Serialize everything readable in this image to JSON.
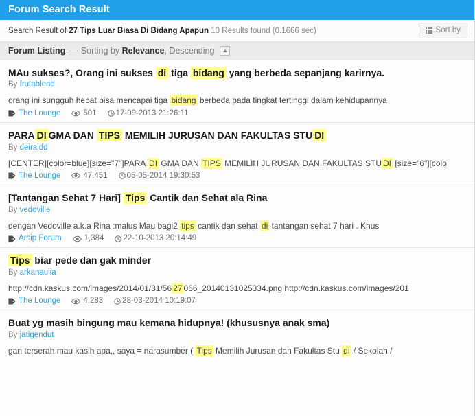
{
  "window": {
    "title": "Forum Search Result"
  },
  "summary": {
    "prefix": "Search Result of",
    "query": "27 Tips Luar Biasa Di Bidang Apapun",
    "count_text": "10 Results found (0.1666 sec)",
    "sort_button_label": "Sort by",
    "sort_button_icon": "list-icon"
  },
  "listing": {
    "title": "Forum Listing",
    "dash": "—",
    "sorting_prefix": "Sorting by",
    "sort_field": "Relevance",
    "sort_direction": "Descending",
    "collapse_icon": "chevron-up-icon"
  },
  "icons": {
    "tag": "tag-icon",
    "views": "eye-icon",
    "time": "clock-icon"
  },
  "colors": {
    "header_blue": "#1fa0e8",
    "highlight_yellow": "#ffff8d",
    "link_blue": "#3a9fd4",
    "listing_bar_gray": "#ebebeb"
  },
  "results": [
    {
      "title_parts": [
        {
          "text": "MAu sukses?, Orang ini sukses ",
          "hl": false
        },
        {
          "text": "di",
          "hl": true
        },
        {
          "text": " tiga ",
          "hl": false
        },
        {
          "text": "bidang",
          "hl": true
        },
        {
          "text": " yang berbeda sepanjang karirnya.",
          "hl": false
        }
      ],
      "title_plain": "MAu sukses?, Orang ini sukses di tiga bidang yang berbeda sepanjang karirnya.",
      "by_label": "By",
      "author": "frutablend",
      "snippet_parts": [
        {
          "text": "orang ini sungguh hebat bisa mencapai tiga ",
          "hl": false
        },
        {
          "text": "bidang",
          "hl": true
        },
        {
          "text": " berbeda pada tingkat tertinggi dalam kehidupannya",
          "hl": false
        }
      ],
      "snippet_plain": "orang ini sungguh hebat bisa mencapai tiga bidang berbeda pada tingkat tertinggi dalam kehidupannya",
      "forum": "The Lounge",
      "views": "501",
      "date": "17-09-2013 21:26:11"
    },
    {
      "title_parts": [
        {
          "text": "PARA",
          "hl": false
        },
        {
          "text": "DI",
          "hl": true
        },
        {
          "text": "GMA DAN ",
          "hl": false
        },
        {
          "text": "TIPS",
          "hl": true
        },
        {
          "text": " MEMILIH JURUSAN DAN FAKULTAS STU",
          "hl": false
        },
        {
          "text": "DI",
          "hl": true
        }
      ],
      "title_plain": "PARADIGMA DAN TIPS MEMILIH JURUSAN DAN FAKULTAS STUDI",
      "by_label": "By",
      "author": "deiraldd",
      "snippet_parts": [
        {
          "text": "[CENTER][color=blue][size=\"7\"]PARA ",
          "hl": false
        },
        {
          "text": "DI",
          "hl": true
        },
        {
          "text": " GMA DAN ",
          "hl": false
        },
        {
          "text": "TIPS",
          "hl": true
        },
        {
          "text": " MEMILIH JURUSAN DAN FAKULTAS STU",
          "hl": false
        },
        {
          "text": "DI",
          "hl": true
        },
        {
          "text": " [size=\"6\"][colo",
          "hl": false
        }
      ],
      "snippet_plain": "[CENTER][color=blue][size=\"7\"]PARA DI GMA DAN TIPS MEMILIH JURUSAN DAN FAKULTAS STU DI [size=\"6\"][colo",
      "forum": "The Lounge",
      "views": "47,451",
      "date": "05-05-2014 19:30:53"
    },
    {
      "title_parts": [
        {
          "text": "[Tantangan Sehat 7 Hari] ",
          "hl": false
        },
        {
          "text": "Tips",
          "hl": true
        },
        {
          "text": " Cantik dan Sehat ala Rina",
          "hl": false
        }
      ],
      "title_plain": "[Tantangan Sehat 7 Hari] Tips Cantik dan Sehat ala Rina",
      "by_label": "By",
      "author": "vedoville",
      "snippet_parts": [
        {
          "text": "dengan Vedoville a.k.a Rina :malus Mau bagi2 ",
          "hl": false
        },
        {
          "text": "tips",
          "hl": true
        },
        {
          "text": " cantik dan sehat ",
          "hl": false
        },
        {
          "text": "di",
          "hl": true
        },
        {
          "text": " tantangan sehat 7 hari . Khus",
          "hl": false
        }
      ],
      "snippet_plain": "dengan Vedoville a.k.a Rina :malus Mau bagi2 tips cantik dan sehat di tantangan sehat 7 hari . Khus",
      "forum": "Arsip Forum",
      "views": "1,384",
      "date": "22-10-2013 20:14:49"
    },
    {
      "title_parts": [
        {
          "text": "Tips",
          "hl": true
        },
        {
          "text": " biar pede dan gak minder",
          "hl": false
        }
      ],
      "title_plain": "Tips biar pede dan gak minder",
      "by_label": "By",
      "author": "arkanaulia",
      "snippet_parts": [
        {
          "text": "http://cdn.kaskus.com/images/2014/01/31/56",
          "hl": false
        },
        {
          "text": "27",
          "hl": true
        },
        {
          "text": "066_20140131025334.png http://cdn.kaskus.com/images/201",
          "hl": false
        }
      ],
      "snippet_plain": "http://cdn.kaskus.com/images/2014/01/31/5627066_20140131025334.png http://cdn.kaskus.com/images/201",
      "forum": "The Lounge",
      "views": "4,283",
      "date": "28-03-2014 10:19:07"
    },
    {
      "title_parts": [
        {
          "text": "Buat yg masih bingung mau kemana hidupnya! (khususnya anak sma)",
          "hl": false
        }
      ],
      "title_plain": "Buat yg masih bingung mau kemana hidupnya! (khususnya anak sma)",
      "by_label": "By",
      "author": "jatigendut",
      "snippet_parts": [
        {
          "text": "gan terserah mau kasih apa,, saya = narasumber ( ",
          "hl": false
        },
        {
          "text": "Tips",
          "hl": true
        },
        {
          "text": " Memilih Jurusan dan Fakultas Stu ",
          "hl": false
        },
        {
          "text": "di",
          "hl": true
        },
        {
          "text": " / Sekolah /",
          "hl": false
        }
      ],
      "snippet_plain": "gan terserah mau kasih apa,, saya = narasumber ( Tips Memilih Jurusan dan Fakultas Stu di / Sekolah /",
      "forum": "",
      "views": "",
      "date": ""
    }
  ]
}
